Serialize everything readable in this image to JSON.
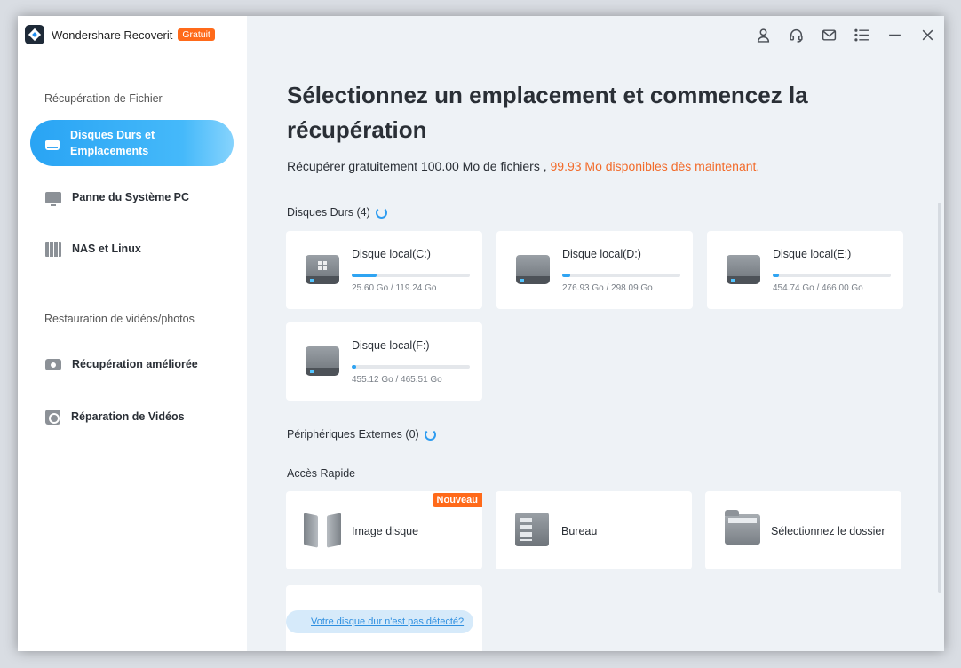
{
  "app": {
    "name": "Wondershare Recoverit",
    "badge": "Gratuit"
  },
  "sidebar": {
    "section1_title": "Récupération de Fichier",
    "section2_title": "Restauration de vidéos/photos",
    "items": [
      {
        "label_line1": "Disques Durs et",
        "label_line2": "Emplacements",
        "icon": "hard-drive-icon",
        "active": true
      },
      {
        "label": "Panne du Système PC",
        "icon": "monitor-icon"
      },
      {
        "label": "NAS et Linux",
        "icon": "nas-icon"
      },
      {
        "label": "Récupération améliorée",
        "icon": "camera-icon"
      },
      {
        "label": "Réparation de Vidéos",
        "icon": "video-repair-icon"
      }
    ]
  },
  "window_controls": [
    "user-icon",
    "headset-icon",
    "mail-icon",
    "menu-icon",
    "minimize-icon",
    "close-icon"
  ],
  "main": {
    "headline": "Sélectionnez un emplacement et commencez la récupération",
    "subline_prefix": "Récupérer gratuitement 100.00 Mo de fichiers ,",
    "subline_accent": "99.93 Mo disponibles dès maintenant.",
    "hard_disks_label": "Disques Durs (4)",
    "disks": [
      {
        "name": "Disque local(C:)",
        "size": "25.60 Go / 119.24 Go",
        "usage": 0.21,
        "system": true
      },
      {
        "name": "Disque local(D:)",
        "size": "276.93 Go / 298.09 Go",
        "usage": 0.07,
        "system": false
      },
      {
        "name": "Disque local(E:)",
        "size": "454.74 Go / 466.00 Go",
        "usage": 0.05,
        "system": false
      },
      {
        "name": "Disque local(F:)",
        "size": "455.12 Go / 465.51 Go",
        "usage": 0.04,
        "system": false
      }
    ],
    "external_label": "Périphériques Externes (0)",
    "quick_access_label": "Accès Rapide",
    "quick_access": [
      {
        "label": "Image disque",
        "badge": "Nouveau",
        "icon": "disk-image-icon"
      },
      {
        "label": "Bureau",
        "icon": "desktop-icon"
      },
      {
        "label": "Sélectionnez le dossier",
        "icon": "folder-icon"
      }
    ],
    "help_link": "Votre disque dur n'est pas détecté?"
  },
  "colors": {
    "accent": "#2fa4f2",
    "orange": "#f26b2a",
    "badge": "#ff6a1a"
  }
}
